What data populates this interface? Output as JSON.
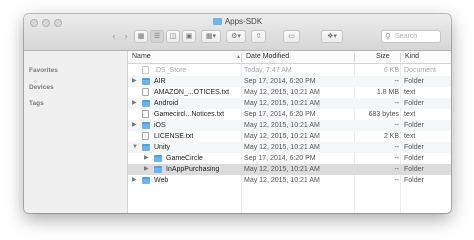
{
  "window": {
    "title": "Apps-SDK"
  },
  "sidebar": {
    "sections": [
      {
        "label": "Favorites"
      },
      {
        "label": "Devices"
      },
      {
        "label": "Tags"
      }
    ]
  },
  "toolbar": {
    "back_icon": "back-arrow-icon",
    "forward_icon": "forward-arrow-icon",
    "views": [
      "icon-view-icon",
      "list-view-icon",
      "column-view-icon",
      "coverflow-view-icon"
    ],
    "arrange_icon": "arrange-icon",
    "action_icon": "gear-icon",
    "share_icon": "share-icon",
    "tags_icon": "tag-icon",
    "dropbox_icon": "dropbox-icon",
    "search_placeholder": "Search"
  },
  "columns": {
    "name": "Name",
    "date": "Date Modified",
    "size": "Size",
    "kind": "Kind"
  },
  "files": [
    {
      "name": ".DS_Store",
      "date": "Today, 7:47 AM",
      "size": "6 KB",
      "kind": "Document",
      "type": "file",
      "dim": true,
      "disclosure": "",
      "indent": 0
    },
    {
      "name": "AIR",
      "date": "Sep 17, 2014, 6:20 PM",
      "size": "--",
      "kind": "Folder",
      "type": "folder",
      "disclosure": "▶",
      "indent": 0
    },
    {
      "name": "AMAZON_...OTICES.txt",
      "date": "May 12, 2015, 10:21 AM",
      "size": "1.8 MB",
      "kind": "text",
      "type": "file",
      "disclosure": "",
      "indent": 0
    },
    {
      "name": "Android",
      "date": "May 12, 2015, 10:21 AM",
      "size": "--",
      "kind": "Folder",
      "type": "folder",
      "disclosure": "▶",
      "indent": 0
    },
    {
      "name": "Gamecircl...Notices.txt",
      "date": "Sep 17, 2014, 6:20 PM",
      "size": "683 bytes",
      "kind": "text",
      "type": "file",
      "disclosure": "",
      "indent": 0
    },
    {
      "name": "iOS",
      "date": "May 12, 2015, 10:21 AM",
      "size": "--",
      "kind": "Folder",
      "type": "folder",
      "disclosure": "▶",
      "indent": 0
    },
    {
      "name": "LICENSE.txt",
      "date": "May 12, 2015, 10:21 AM",
      "size": "2 KB",
      "kind": "text",
      "type": "file",
      "disclosure": "",
      "indent": 0
    },
    {
      "name": "Unity",
      "date": "May 12, 2015, 10:21 AM",
      "size": "--",
      "kind": "Folder",
      "type": "folder",
      "disclosure": "▼",
      "indent": 0
    },
    {
      "name": "GameCircle",
      "date": "Sep 17, 2014, 6:20 PM",
      "size": "--",
      "kind": "Folder",
      "type": "folder",
      "disclosure": "▶",
      "indent": 1
    },
    {
      "name": "InAppPurchasing",
      "date": "May 12, 2015, 10:21 AM",
      "size": "--",
      "kind": "Folder",
      "type": "folder",
      "disclosure": "▶",
      "indent": 1,
      "selected": true
    },
    {
      "name": "Web",
      "date": "May 12, 2015, 10:21 AM",
      "size": "--",
      "kind": "Folder",
      "type": "folder",
      "disclosure": "▶",
      "indent": 0
    }
  ],
  "colors": {
    "folder": "#6cb4ef",
    "selection": "#dcdcdc",
    "sidebar": "#f0f0f0"
  }
}
